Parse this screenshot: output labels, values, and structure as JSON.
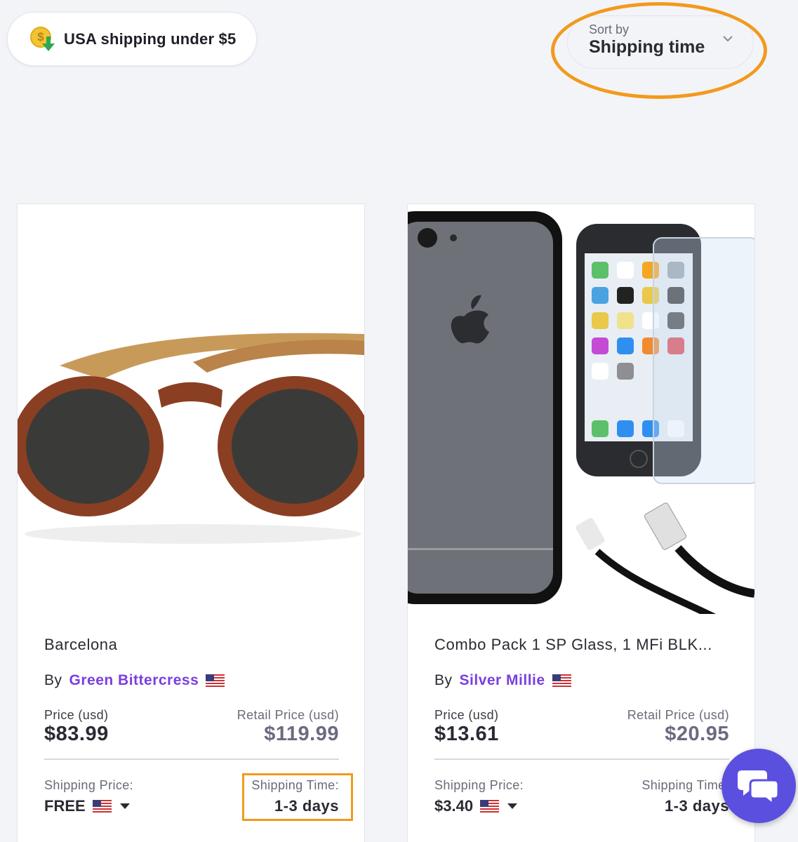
{
  "filter": {
    "label": "USA shipping under $5",
    "icon": "dollar-coin-down-arrow-icon"
  },
  "sort": {
    "label": "Sort by",
    "value": "Shipping time",
    "icon": "chevron-down-icon"
  },
  "colors": {
    "accent_purple": "#7a3fe0",
    "highlight_orange": "#f29a1d",
    "chat_button": "#5b4fe0",
    "background": "#f3f4f8"
  },
  "products": [
    {
      "title": "Barcelona",
      "by_label": "By",
      "seller": "Green Bittercress",
      "price_label": "Price (usd)",
      "price": "$83.99",
      "retail_label": "Retail Price (usd)",
      "retail_price": "$119.99",
      "shipping_price_label": "Shipping Price:",
      "shipping_price": "FREE",
      "shipping_time_label": "Shipping Time:",
      "shipping_time": "1-3 days"
    },
    {
      "title": "Combo Pack 1 SP Glass, 1 MFi BLK...",
      "by_label": "By",
      "seller": "Silver Millie",
      "price_label": "Price (usd)",
      "price": "$13.61",
      "retail_label": "Retail Price (usd)",
      "retail_price": "$20.95",
      "shipping_price_label": "Shipping Price:",
      "shipping_price": "$3.40",
      "shipping_time_label": "Shipping Time:",
      "shipping_time": "1-3 days"
    }
  ],
  "chat": {
    "icon": "chat-bubbles-icon"
  }
}
